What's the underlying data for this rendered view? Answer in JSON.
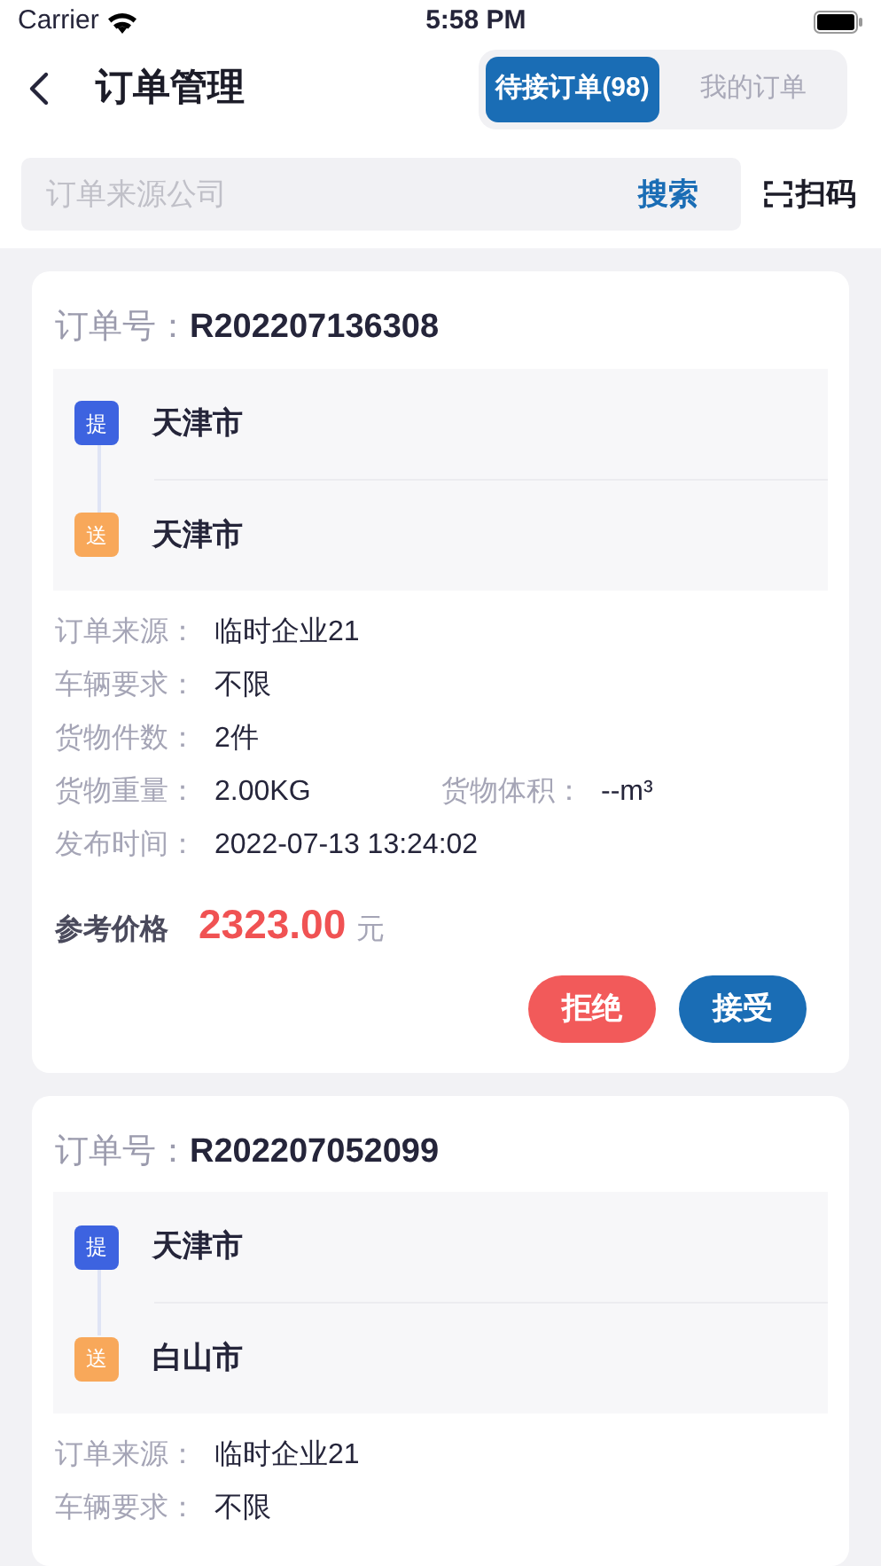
{
  "status_bar": {
    "carrier": "Carrier",
    "time": "5:58 PM"
  },
  "header": {
    "title": "订单管理",
    "tabs": [
      {
        "label": "待接订单(98)",
        "selected": true
      },
      {
        "label": "我的订单",
        "selected": false
      }
    ]
  },
  "search": {
    "placeholder": "订单来源公司",
    "button": "搜索"
  },
  "scan_button": "扫码",
  "orders": [
    {
      "order_label": "订单号：",
      "order_no": "R202207136308",
      "stops": [
        {
          "kind": "pickup",
          "badge": "提",
          "city": "天津市"
        },
        {
          "kind": "delivery",
          "badge": "送",
          "city": "天津市"
        }
      ],
      "fields": [
        [
          {
            "label": "订单来源：",
            "value": "临时企业21"
          }
        ],
        [
          {
            "label": "车辆要求：",
            "value": "不限"
          }
        ],
        [
          {
            "label": "货物件数：",
            "value": "2件"
          }
        ],
        [
          {
            "label": "货物重量：",
            "value": "2.00KG"
          },
          {
            "label": "货物体积：",
            "value": "--m³"
          }
        ],
        [
          {
            "label": "发布时间：",
            "value": "2022-07-13 13:24:02"
          }
        ]
      ],
      "price": {
        "label": "参考价格",
        "amount": "2323.00",
        "unit": "元"
      },
      "actions": [
        {
          "kind": "reject",
          "label": "拒绝"
        },
        {
          "kind": "accept",
          "label": "接受"
        }
      ]
    },
    {
      "order_label": "订单号：",
      "order_no": "R202207052099",
      "stops": [
        {
          "kind": "pickup",
          "badge": "提",
          "city": "天津市"
        },
        {
          "kind": "delivery",
          "badge": "送",
          "city": "白山市"
        }
      ],
      "fields": [
        [
          {
            "label": "订单来源：",
            "value": "临时企业21"
          }
        ],
        [
          {
            "label": "车辆要求：",
            "value": "不限"
          }
        ]
      ]
    }
  ]
}
